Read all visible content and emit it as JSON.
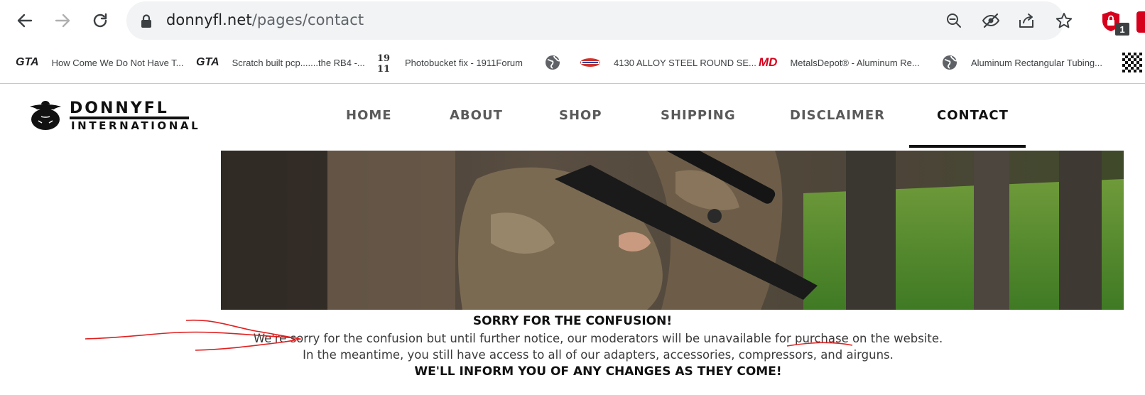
{
  "browser": {
    "url_domain": "donnyfl.net",
    "url_path": "/pages/contact",
    "extension_badge": "1",
    "bookmarks": [
      {
        "icon": "gta-logo",
        "fav_text": "GTA",
        "label": "How Come We Do Not Have T..."
      },
      {
        "icon": "gta-logo",
        "fav_text": "GTA",
        "label": "Scratch built pcp.......the RB4 -..."
      },
      {
        "icon": "1911-logo",
        "fav_text": "19 11",
        "label": "Photobucket fix - 1911Forum"
      },
      {
        "icon": "globe-icon",
        "fav_text": "",
        "label": ""
      },
      {
        "icon": "steel-logo",
        "fav_text": "",
        "label": "4130 ALLOY STEEL ROUND SE..."
      },
      {
        "icon": "md-logo",
        "fav_text": "MD",
        "label": "MetalsDepot® - Aluminum Re..."
      },
      {
        "icon": "globe-icon",
        "fav_text": "",
        "label": "Aluminum Rectangular Tubing..."
      }
    ]
  },
  "site": {
    "logo_word": "DONNYFL",
    "logo_sub": "INTERNATIONAL",
    "nav": [
      {
        "label": "HOME",
        "active": false
      },
      {
        "label": "ABOUT",
        "active": false
      },
      {
        "label": "SHOP",
        "active": false
      },
      {
        "label": "SHIPPING",
        "active": false
      },
      {
        "label": "DISCLAIMER",
        "active": false
      },
      {
        "label": "CONTACT",
        "active": true
      }
    ]
  },
  "notice": {
    "title": "SORRY FOR THE CONFUSION!",
    "line1": "We're sorry for the confusion but until further notice, our moderators will be unavailable for purchase on the website.",
    "line2": "In the meantime, you still have access to all of our adapters, accessories, compressors, and airguns.",
    "bottom": "WE'LL INFORM YOU OF ANY CHANGES AS THEY COME!"
  },
  "colors": {
    "active_nav": "#111111",
    "inactive_nav": "#5a5a5a",
    "annotation": "#e02020"
  }
}
